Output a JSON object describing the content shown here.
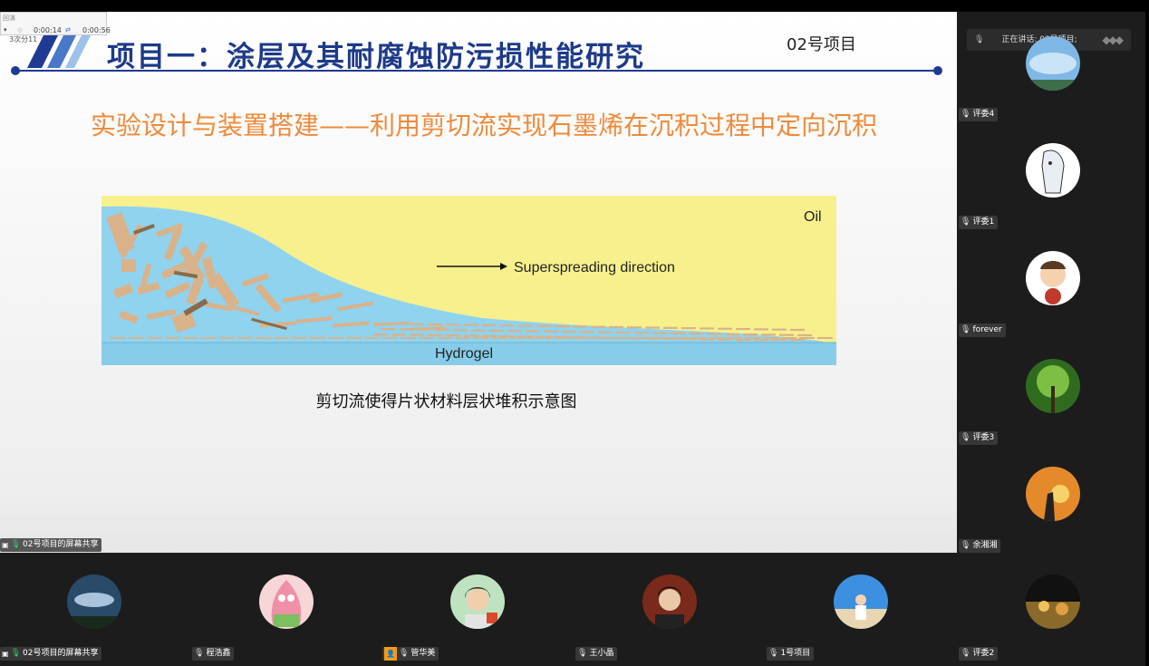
{
  "slide": {
    "title": "项目一：涂层及其耐腐蚀防污损性能研究",
    "project_label": "02号项目",
    "subtitle": "实验设计与装置搭建——利用剪切流实现石墨烯在沉积过程中定向沉积",
    "figure": {
      "oil_label": "Oil",
      "direction_label": "Superspreading direction",
      "hydrogel_label": "Hydrogel"
    },
    "caption": "剪切流使得片状材料层状堆积示意图"
  },
  "recorder": {
    "label": "回演",
    "elapsed": "0:00:14",
    "total": "0:00:56",
    "under_text": "3次分11"
  },
  "share_tag": "02号项目的屏幕共享",
  "speaking": {
    "text": "正在讲话: 02号项目;"
  },
  "right_participants": [
    {
      "name": "评委4",
      "avatar": "sky-avatar"
    },
    {
      "name": "评委1",
      "avatar": "sketch-avatar"
    },
    {
      "name": "forever",
      "avatar": "cartoon-avatar"
    },
    {
      "name": "评委3",
      "avatar": "forest-avatar"
    },
    {
      "name": "余湘湘",
      "avatar": "sunset-avatar"
    },
    {
      "name": "评委2",
      "avatar": "night-avatar"
    }
  ],
  "bottom_participants": [
    {
      "name": "02号项目的屏幕共享",
      "avatar": "cloud-avatar"
    },
    {
      "name": "程浩鑫",
      "avatar": "patrick-avatar"
    },
    {
      "name": "管华美",
      "avatar": "woman-avatar"
    },
    {
      "name": "王小晶",
      "avatar": "man-avatar"
    },
    {
      "name": "1号项目",
      "avatar": "beach-avatar"
    }
  ],
  "colors": {
    "title_blue": "#1d3a8a",
    "subtitle_orange": "#ef8a3a",
    "oil_yellow": "#f7f08c",
    "water_blue": "#8fd3ef",
    "flake_tan": "#d9b28a",
    "panel_bg": "#1c1c1c"
  }
}
